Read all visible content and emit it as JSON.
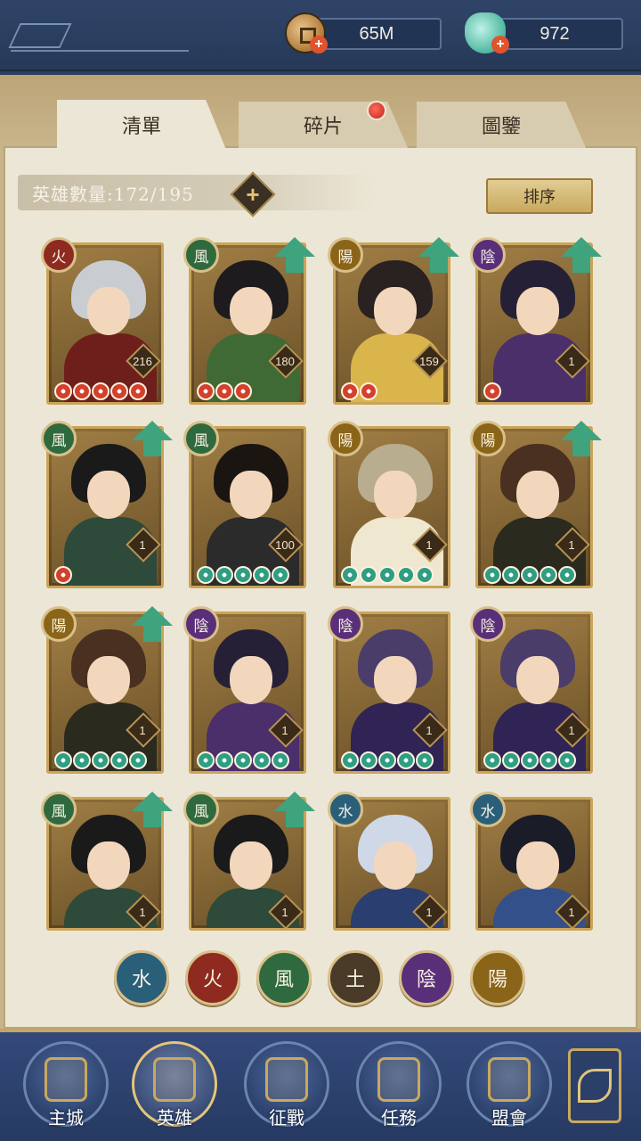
{
  "currency": {
    "coins": "65M",
    "gems": "972",
    "coin_icon": "copper-coin-icon",
    "gem_icon": "jade-pouch-icon",
    "add_symbol": "+"
  },
  "tabs": [
    {
      "label": "清單",
      "active": true
    },
    {
      "label": "碎片",
      "active": false,
      "notification": true
    },
    {
      "label": "圖鑒",
      "active": false
    }
  ],
  "hero_count": {
    "label": "英雄數量:172/195",
    "add_symbol": "+"
  },
  "sort_button": "排序",
  "heroes": [
    {
      "element": "火",
      "level": "216",
      "stars": 5,
      "star_color": "red",
      "upgrade": false,
      "hair": "#c9cdd2",
      "body": "#6e1f1c"
    },
    {
      "element": "風",
      "level": "180",
      "stars": 3,
      "star_color": "red",
      "upgrade": true,
      "hair": "#1d1b1e",
      "body": "#3f6a35"
    },
    {
      "element": "陽",
      "level": "159",
      "stars": 2,
      "star_color": "red",
      "upgrade": true,
      "hair": "#2a2220",
      "body": "#d9b54c"
    },
    {
      "element": "陰",
      "level": "1",
      "stars": 1,
      "star_color": "red",
      "upgrade": true,
      "hair": "#262036",
      "body": "#4a2f6b"
    },
    {
      "element": "風",
      "level": "1",
      "stars": 1,
      "star_color": "red",
      "upgrade": true,
      "hair": "#1a1a1a",
      "body": "#2d4a3a"
    },
    {
      "element": "風",
      "level": "100",
      "stars": 5,
      "star_color": "green",
      "upgrade": false,
      "hair": "#1b1512",
      "body": "#2b2b2b"
    },
    {
      "element": "陽",
      "level": "1",
      "stars": 5,
      "star_color": "green",
      "upgrade": false,
      "hair": "#b9ad8f",
      "body": "#efe7cf"
    },
    {
      "element": "陽",
      "level": "1",
      "stars": 5,
      "star_color": "green",
      "upgrade": true,
      "hair": "#4a3020",
      "body": "#2b2a1e"
    },
    {
      "element": "陽",
      "level": "1",
      "stars": 5,
      "star_color": "green",
      "upgrade": true,
      "hair": "#4a3020",
      "body": "#2b2a1e"
    },
    {
      "element": "陰",
      "level": "1",
      "stars": 5,
      "star_color": "green",
      "upgrade": false,
      "hair": "#262036",
      "body": "#4a2f6b"
    },
    {
      "element": "陰",
      "level": "1",
      "stars": 5,
      "star_color": "green",
      "upgrade": false,
      "hair": "#4a3d6a",
      "body": "#2f2454"
    },
    {
      "element": "陰",
      "level": "1",
      "stars": 5,
      "star_color": "green",
      "upgrade": false,
      "hair": "#4a3d6a",
      "body": "#2f2454"
    },
    {
      "element": "風",
      "level": "1",
      "stars": 0,
      "star_color": "green",
      "upgrade": true,
      "hair": "#1a1a1a",
      "body": "#2d4a3a"
    },
    {
      "element": "風",
      "level": "1",
      "stars": 0,
      "star_color": "green",
      "upgrade": true,
      "hair": "#1a1a1a",
      "body": "#2d4a3a"
    },
    {
      "element": "水",
      "level": "1",
      "stars": 0,
      "star_color": "green",
      "upgrade": false,
      "hair": "#cfd8e6",
      "body": "#2b3e70"
    },
    {
      "element": "水",
      "level": "1",
      "stars": 0,
      "star_color": "green",
      "upgrade": false,
      "hair": "#1a1c28",
      "body": "#33508a"
    }
  ],
  "element_colors": {
    "火": "#8e2a20",
    "風": "#2f6a3f",
    "陽": "#8a6418",
    "陰": "#5a2f7a",
    "水": "#2a5f7a",
    "土": "#4a3a28"
  },
  "element_filters": [
    "水",
    "火",
    "風",
    "土",
    "陰",
    "陽"
  ],
  "bottom_nav": [
    {
      "label": "主城",
      "icon": "palace-icon",
      "active": false
    },
    {
      "label": "英雄",
      "icon": "hero-portrait-icon",
      "active": true
    },
    {
      "label": "征戰",
      "icon": "war-scroll-icon",
      "active": false
    },
    {
      "label": "任務",
      "icon": "quest-book-icon",
      "active": false
    },
    {
      "label": "盟會",
      "icon": "alliance-pavilion-icon",
      "active": false
    }
  ],
  "menu_icon": "flower-menu-icon"
}
